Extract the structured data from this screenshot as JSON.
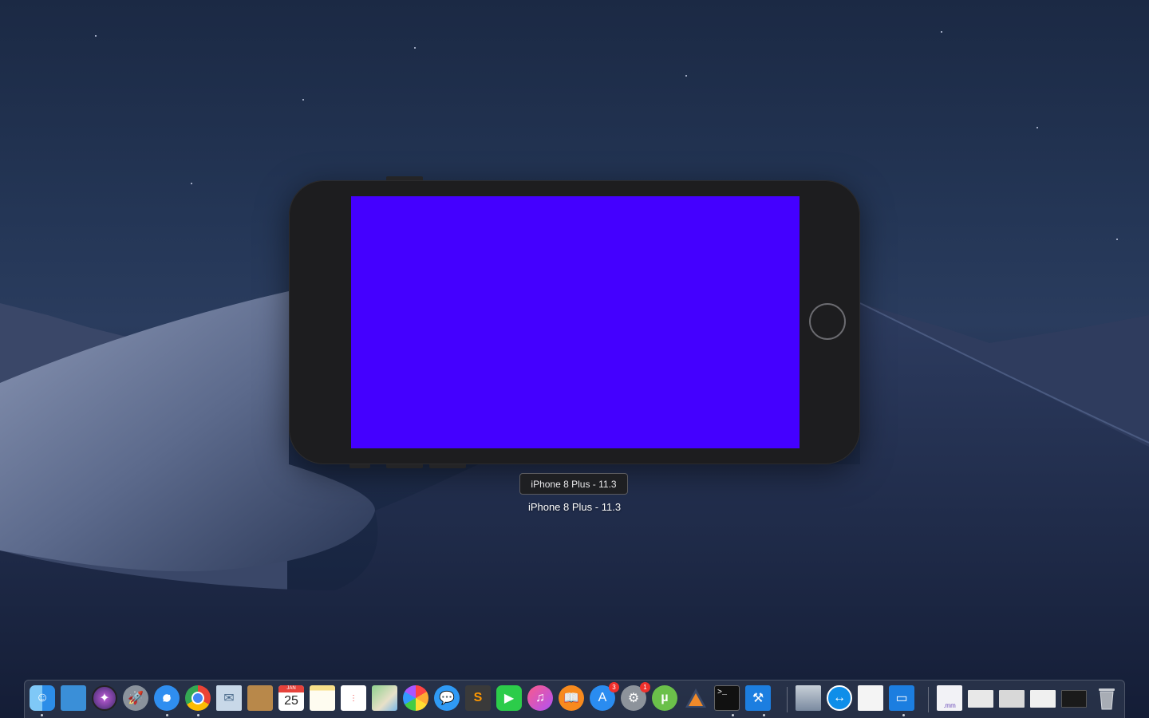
{
  "desktop": {
    "wallpaper": "macOS Mojave night"
  },
  "simulator": {
    "screen_color": "#4400ff",
    "bezel_color": "#1d1d1f",
    "tooltip": "iPhone 8 Plus - 11.3",
    "window_title": "iPhone 8 Plus - 11.3"
  },
  "dock": {
    "apps": [
      {
        "name": "finder-icon",
        "running": true
      },
      {
        "name": "files-icon",
        "running": false
      },
      {
        "name": "siri-icon",
        "running": false
      },
      {
        "name": "launchpad-icon",
        "running": false
      },
      {
        "name": "safari-icon",
        "running": true
      },
      {
        "name": "chrome-icon",
        "running": true
      },
      {
        "name": "mail-icon",
        "running": false
      },
      {
        "name": "contacts-icon",
        "running": false
      },
      {
        "name": "calendar-icon",
        "running": false,
        "month": "JAN",
        "day": "25"
      },
      {
        "name": "notes-icon",
        "running": false
      },
      {
        "name": "reminders-icon",
        "running": false
      },
      {
        "name": "maps-icon",
        "running": false
      },
      {
        "name": "photos-icon",
        "running": false
      },
      {
        "name": "messages-icon",
        "running": false
      },
      {
        "name": "sublime-text-icon",
        "running": false
      },
      {
        "name": "facetime-icon",
        "running": false
      },
      {
        "name": "itunes-icon",
        "running": false
      },
      {
        "name": "ibooks-icon",
        "running": false
      },
      {
        "name": "app-store-icon",
        "running": false,
        "badge": "3"
      },
      {
        "name": "system-preferences-icon",
        "running": false,
        "badge": "1"
      },
      {
        "name": "utorrent-icon",
        "running": false
      },
      {
        "name": "instruments-icon",
        "running": false
      },
      {
        "name": "terminal-icon",
        "running": true
      },
      {
        "name": "xcode-icon",
        "running": true
      },
      {
        "name": "preview-icon",
        "running": false
      },
      {
        "name": "teamviewer-icon",
        "running": false
      },
      {
        "name": "textedit-icon",
        "running": false
      },
      {
        "name": "simulator-icon",
        "running": true
      }
    ],
    "documents": [
      {
        "name": "mm-file-icon",
        "label": ".mm"
      },
      {
        "name": "chrome-window-thumb-1-icon"
      },
      {
        "name": "chrome-window-thumb-2-icon"
      },
      {
        "name": "safari-window-thumb-icon"
      },
      {
        "name": "terminal-window-thumb-icon"
      },
      {
        "name": "trash-icon"
      }
    ]
  }
}
